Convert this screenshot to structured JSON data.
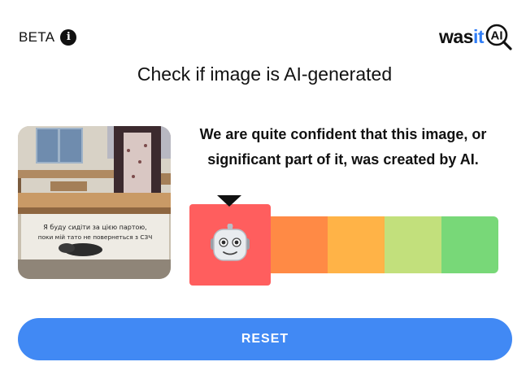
{
  "header": {
    "beta_label": "BETA",
    "info_icon": "info-icon",
    "logo": {
      "was": "was",
      "it": "it",
      "ai": "AI",
      "accent_color": "#2f7df6"
    }
  },
  "main": {
    "title": "Check if image is AI-generated",
    "image_overlay_text": [
      "Я буду сидіти за цією партою,",
      "поки мій тато не повернеться з СЗЧ"
    ],
    "verdict": "We are quite confident that this image, or significant part of it, was created by AI.",
    "scale": {
      "active_level": 1,
      "levels": 5,
      "active_icon": "robot-icon",
      "colors": [
        "#ff5e5e",
        "#ff8a45",
        "#ffb347",
        "#c2e07c",
        "#78d878"
      ]
    },
    "reset_label": "RESET",
    "reset_color": "#4189f4"
  }
}
